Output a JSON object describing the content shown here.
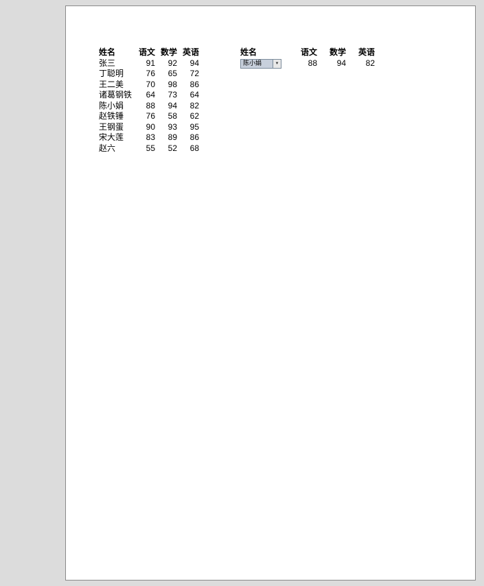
{
  "left": {
    "headers": [
      "姓名",
      "语文",
      "数学",
      "英语"
    ],
    "rows": [
      {
        "name": "张三",
        "chinese": 91,
        "math": 92,
        "english": 94
      },
      {
        "name": "丁聪明",
        "chinese": 76,
        "math": 65,
        "english": 72
      },
      {
        "name": "王二美",
        "chinese": 70,
        "math": 98,
        "english": 86
      },
      {
        "name": "诸葛钢铁",
        "chinese": 64,
        "math": 73,
        "english": 64
      },
      {
        "name": "陈小娟",
        "chinese": 88,
        "math": 94,
        "english": 82
      },
      {
        "name": "赵铁锤",
        "chinese": 76,
        "math": 58,
        "english": 62
      },
      {
        "name": "王钢蛋",
        "chinese": 90,
        "math": 93,
        "english": 95
      },
      {
        "name": "宋大莲",
        "chinese": 83,
        "math": 89,
        "english": 86
      },
      {
        "name": "赵六",
        "chinese": 55,
        "math": 52,
        "english": 68
      }
    ]
  },
  "right": {
    "headers": [
      "姓名",
      "语文",
      "数学",
      "英语"
    ],
    "selected": "陈小娟",
    "row": {
      "chinese": 88,
      "math": 94,
      "english": 82
    }
  }
}
